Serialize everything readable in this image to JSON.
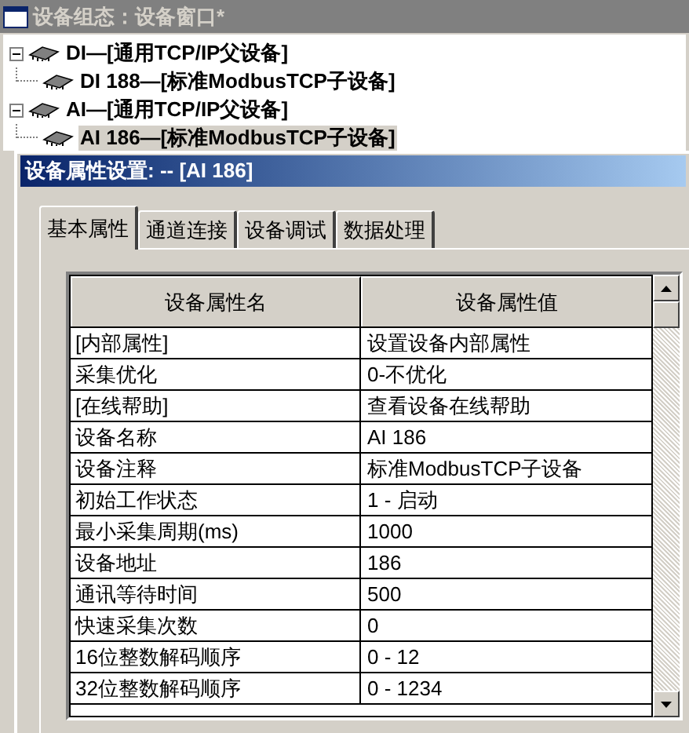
{
  "window": {
    "title": "设备组态：设备窗口*"
  },
  "tree": [
    {
      "label": "DI—[通用TCP/IP父设备]",
      "expanded": true,
      "selected": false,
      "children": [
        {
          "label": "DI 188—[标准ModbusTCP子设备]",
          "selected": false
        }
      ]
    },
    {
      "label": "AI—[通用TCP/IP父设备]",
      "expanded": true,
      "selected": false,
      "children": [
        {
          "label": "AI 186—[标准ModbusTCP子设备]",
          "selected": true
        }
      ]
    }
  ],
  "dialog": {
    "title": "设备属性设置: -- [AI 186]"
  },
  "tabs": [
    {
      "label": "基本属性",
      "selected": true
    },
    {
      "label": "通道连接",
      "selected": false
    },
    {
      "label": "设备调试",
      "selected": false
    },
    {
      "label": "数据处理",
      "selected": false
    }
  ],
  "table": {
    "columns": [
      "设备属性名",
      "设备属性值"
    ],
    "rows": [
      {
        "name": "[内部属性]",
        "value": "设置设备内部属性"
      },
      {
        "name": "采集优化",
        "value": "0-不优化"
      },
      {
        "name": "[在线帮助]",
        "value": "查看设备在线帮助"
      },
      {
        "name": "设备名称",
        "value": "AI 186"
      },
      {
        "name": "设备注释",
        "value": "标准ModbusTCP子设备"
      },
      {
        "name": "初始工作状态",
        "value": "1 - 启动"
      },
      {
        "name": "最小采集周期(ms)",
        "value": "1000"
      },
      {
        "name": "设备地址",
        "value": "186"
      },
      {
        "name": "通讯等待时间",
        "value": "500"
      },
      {
        "name": "快速采集次数",
        "value": "0"
      },
      {
        "name": "16位整数解码顺序",
        "value": "0 - 12"
      },
      {
        "name": "32位整数解码顺序",
        "value": "0 - 1234"
      }
    ]
  }
}
